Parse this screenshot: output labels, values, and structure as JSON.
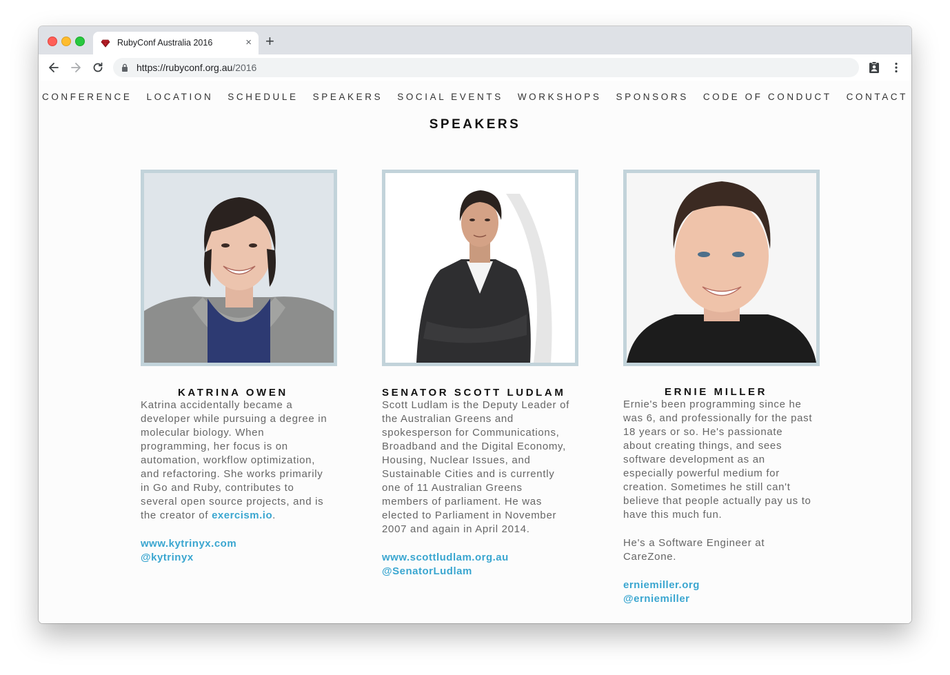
{
  "browser": {
    "tab_title": "RubyConf Australia 2016",
    "tab_close": "×",
    "new_tab": "+",
    "url_host": "https://rubyconf.org.au",
    "url_path": "/2016"
  },
  "nav": {
    "items": [
      "CONFERENCE",
      "LOCATION",
      "SCHEDULE",
      "SPEAKERS",
      "SOCIAL EVENTS",
      "WORKSHOPS",
      "SPONSORS",
      "CODE OF CONDUCT",
      "CONTACT"
    ]
  },
  "section": {
    "title": "SPEAKERS"
  },
  "speakers": [
    {
      "name": "KATRINA OWEN",
      "bio_text": "Katrina accidentally became a developer while pursuing a degree in molecular biology. When programming, her focus is on automation, workflow optimization, and refactoring. She works primarily in Go and Ruby, contributes to several open source projects, and is the creator of ",
      "bio_link": "exercism.io",
      "bio_end": ".",
      "site": "www.kytrinyx.com",
      "handle": "@kytrinyx"
    },
    {
      "name": "SENATOR SCOTT LUDLAM",
      "bio_text": "Scott Ludlam is the Deputy Leader of the Australian Greens and spokesperson for Communications, Broadband and the Digital Economy, Housing, Nuclear Issues, and Sustainable Cities and is currently one of 11 Australian Greens members of parliament. He was elected to Parliament in November 2007 and again in April 2014.",
      "site": "www.scottludlam.org.au",
      "handle": "@SenatorLudlam"
    },
    {
      "name": "ERNIE MILLER",
      "bio_text": "Ernie's been programming since he was 6, and professionally for the past 18 years or so. He's passionate about creating things, and sees software development as an especially powerful medium for creation. Sometimes he still can't believe that people actually pay us to have this much fun.",
      "bio_text2": "He's a Software Engineer at CareZone.",
      "site": "erniemiller.org",
      "handle": "@erniemiller"
    }
  ]
}
